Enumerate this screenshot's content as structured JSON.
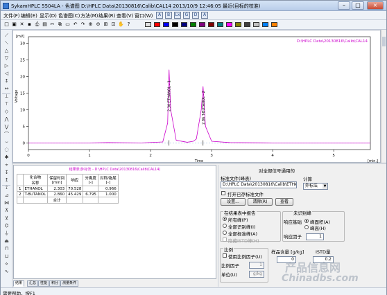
{
  "window": {
    "title": "SykamHPLC 5504LA - 色谱图  D:\\HPLC Data\\20130816\\Calib\\CAL14  2013/10/9 12:46:05 最近(目标的校准)",
    "minimize": "–",
    "maximize": "□",
    "close": "×"
  },
  "menu": {
    "items": [
      "文件(F)",
      "编辑(E)",
      "显示(D)",
      "色谱图(C)",
      "方法(M)",
      "结果(R)",
      "查看(V)",
      "窗口(W)"
    ],
    "icon_labels": [
      "A",
      "B",
      "Lx",
      "G",
      "D",
      "A"
    ]
  },
  "toolbar": {
    "icons": [
      "new-icon",
      "open-icon",
      "delete-icon",
      "save-icon",
      "print-icon",
      "print-preview-icon",
      "cut-icon",
      "copy-icon",
      "paste-icon",
      "undo-icon",
      "redo-icon",
      "zoom-in-icon",
      "zoom-out-icon",
      "zoom-fit-icon",
      "zoom-window-icon",
      "hand-icon",
      "help-icon"
    ],
    "colors": [
      "#e0e0e0",
      "#ff0000",
      "#0000ff",
      "#000000",
      "#000080",
      "#008000",
      "#800080",
      "#800000",
      "#008080",
      "#ff00ff",
      "#808000",
      "#404040",
      "#c0c0c0",
      "#0080ff",
      "#ff8000"
    ]
  },
  "chromatogram": {
    "y_unit": "[mV]",
    "y_axis_title": "Voltage",
    "x_axis_title": "Time",
    "x_unit": "[min.]",
    "legend": "D:\\HPLC Data\\20130816\\Calib\\CAL14",
    "legend_color": "#cc00cc",
    "trace_color": "#cc00cc"
  },
  "chart_data": {
    "type": "line",
    "title": "",
    "xlabel": "Time",
    "ylabel": "Voltage",
    "x_unit": "[min.]",
    "y_unit": "[mV]",
    "xlim": [
      0,
      5.6
    ],
    "ylim": [
      -2,
      32
    ],
    "x_ticks": [
      0,
      1,
      2,
      3,
      4,
      5
    ],
    "y_ticks": [
      0,
      5,
      10,
      15,
      20,
      25,
      30
    ],
    "series": [
      {
        "name": "D:\\HPLC Data\\20130816\\Calib\\CAL14",
        "x": [
          0,
          1.0,
          1.3,
          1.85,
          2.2,
          2.28,
          2.303,
          2.33,
          2.42,
          2.6,
          2.7,
          2.75,
          2.83,
          2.86,
          2.9,
          3.0,
          3.3,
          4.0,
          5.0,
          5.6
        ],
        "y": [
          0,
          0,
          0.1,
          0,
          0.3,
          6,
          22,
          10,
          0.8,
          0.2,
          0.5,
          1.2,
          10,
          17,
          5,
          0.5,
          0.1,
          0,
          0,
          0
        ]
      }
    ],
    "peak_labels": [
      {
        "time": 2.303,
        "label": "2.30 ETHANOL - 1"
      },
      {
        "time": 2.86,
        "label": "2.86 T-BUTANOL - 2"
      }
    ]
  },
  "results": {
    "title": "结果表(外标法 - D:\\HPLC Data\\20130816\\Calib\\CAL14)",
    "headers": [
      "",
      "化合物\n名称",
      "保留时间\n[min]",
      "响应",
      "分离度\n[-]",
      "对称/拖尾\n[-]"
    ],
    "rows": [
      [
        "1",
        "ETHANOL",
        "2.303",
        "70.528",
        "",
        "0.966"
      ],
      [
        "2",
        "T-BUTANOL",
        "2.860",
        "45.429",
        "6.795",
        "1.000"
      ]
    ],
    "total_label": "合计"
  },
  "tabs": [
    "结果",
    "汇总",
    "性能",
    "积分",
    "测量条件"
  ],
  "settings": {
    "all_peaks_header": "对全部信号通用的",
    "std_file_label": "标准文件(峰表)",
    "std_file_value": "D:\\HPLC Data\\20130816\\Calib\\ETHANOL",
    "print_std_label": "打开已存标准文件",
    "setup_btn": "设置...",
    "clear_btn": "清除(R)",
    "view_btn": "查看",
    "calc_label": "计算",
    "calc_value": "外标法",
    "report_group": "在结果表中报告",
    "report_opts": [
      "所有峰(P)",
      "全部识别峰(I)",
      "全部标准峰(A)"
    ],
    "hide_label": "隐藏ISTD峰(H)",
    "unknown_group": "未识别峰",
    "response_base": "响应基础",
    "area_opt": "峰面积(A)",
    "height_opt": "峰高(H)",
    "resp_factor_label": "响应因子",
    "resp_factor_value": "1",
    "scale_group": "比例",
    "use_scale_label": "使用比例因子(U)",
    "scale_factor_label": "比例因子",
    "scale_factor_value": "1",
    "unit_label": "单位(U)",
    "unit_value": "g/kg",
    "sample_amount_label": "样品含量 [g/kg]",
    "sample_amount_value": "0",
    "istd_label": "ISTD量",
    "istd_value": "0.2"
  },
  "status": "需要帮助，按F1",
  "watermark": {
    "line1": "产品信息网",
    "line2": "Chinadbs.com"
  }
}
